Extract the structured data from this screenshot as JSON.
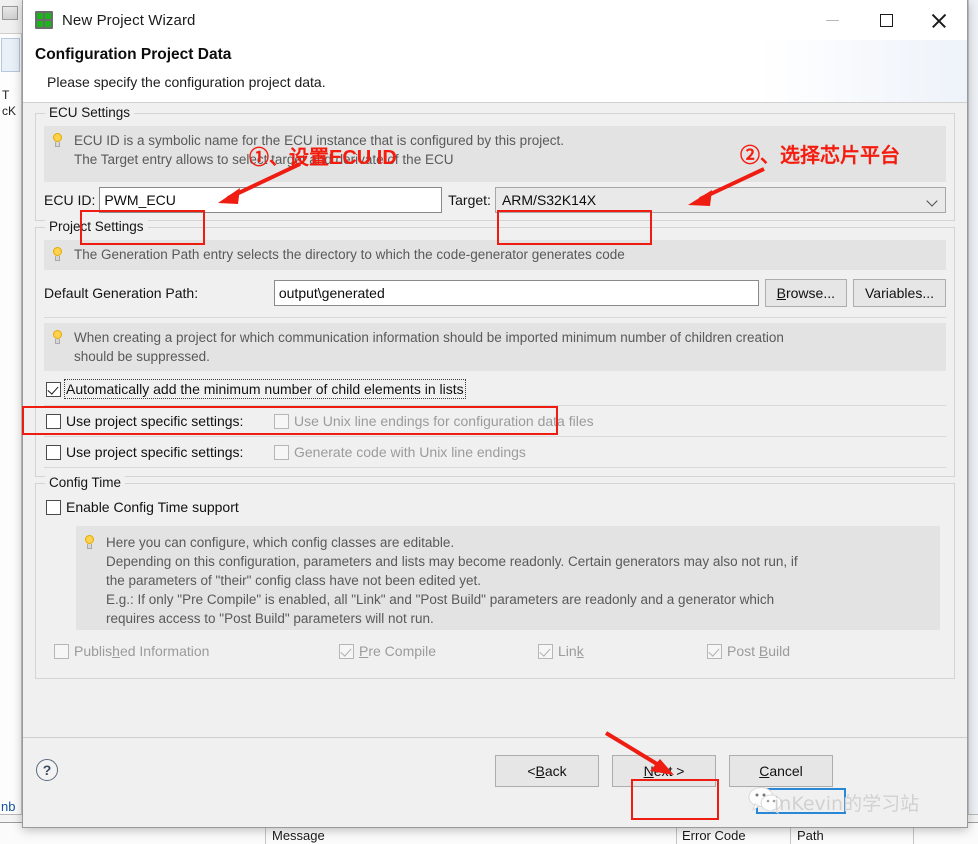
{
  "background": {
    "left_labels": [
      "T",
      "cK"
    ],
    "blue_text": "nb",
    "columns": [
      "Message",
      "Error Code",
      "Path"
    ]
  },
  "window": {
    "title": "New Project Wizard",
    "icon": "app-grid-icon",
    "controls": {
      "minimize": "minimize-icon",
      "maximize": "maximize-icon",
      "close": "close-icon"
    }
  },
  "header": {
    "title": "Configuration Project Data",
    "subtitle": "Please specify the configuration project data."
  },
  "ecu_settings": {
    "group_title": "ECU Settings",
    "hint_lines": [
      "ECU ID is a symbolic name for the ECU instance that is configured by this project.",
      "The Target entry allows to select target and derivate of the ECU"
    ],
    "ecu_id_label": "ECU ID:",
    "ecu_id_value": "PWM_ECU",
    "target_label": "Target:",
    "target_value": "ARM/S32K14X"
  },
  "project_settings": {
    "group_title": "Project Settings",
    "hint_lines": [
      "The Generation Path entry selects the directory to which the code-generator generates code"
    ],
    "gen_path_label": "Default Generation Path:",
    "gen_path_value": "output\\generated",
    "browse_label_pre": "",
    "browse_label_mn": "B",
    "browse_label_post": "rowse...",
    "variables_label": "Variables...",
    "hint2_lines": [
      "When creating a project for which communication information should be imported minimum number of children creation",
      "should be suppressed."
    ],
    "auto_add_label": "Automatically add the minimum number of child elements in lists",
    "auto_add_checked": true,
    "row_unix_data": {
      "left_label": "Use project specific settings:",
      "left_checked": false,
      "right_label": "Use Unix line endings for configuration data files",
      "right_checked": false
    },
    "row_unix_code": {
      "left_label": "Use project specific settings:",
      "left_checked": false,
      "right_label": "Generate code with Unix line endings",
      "right_checked": false
    }
  },
  "config_time": {
    "group_title": "Config Time",
    "enable_label": "Enable Config Time support",
    "enable_checked": false,
    "hint_lines": [
      "Here you can configure, which config classes are editable.",
      "Depending on this configuration, parameters and lists may become readonly. Certain generators may also not run, if",
      "the parameters of \"their\" config class have not been edited yet.",
      "E.g.: If only \"Pre Compile\" is enabled, all \"Link\" and \"Post Build\" parameters are readonly and a generator which",
      "requires access to \"Post Build\" parameters will not run."
    ],
    "classes": [
      {
        "pre": "Publis",
        "mn": "h",
        "post": "ed Information",
        "checked": false
      },
      {
        "pre": "",
        "mn": "P",
        "post": "re Compile",
        "checked": true
      },
      {
        "pre": "Lin",
        "mn": "k",
        "post": "",
        "checked": true
      },
      {
        "pre": "Post ",
        "mn": "B",
        "post": "uild",
        "checked": true
      }
    ]
  },
  "footer": {
    "help_glyph": "?",
    "back_pre": "< ",
    "back_mn": "B",
    "back_post": "ack",
    "next_pre": "",
    "next_mn": "N",
    "next_post": "ext >",
    "cancel_pre": "",
    "cancel_mn": "C",
    "cancel_post": "ancel"
  },
  "annotations": {
    "note1": "①、设置ECU ID",
    "note2": "②、选择芯片平台",
    "accent_color": "#ee1c11"
  },
  "watermark": {
    "text": "inKevin的学习站",
    "icon": "wechat-icon"
  }
}
